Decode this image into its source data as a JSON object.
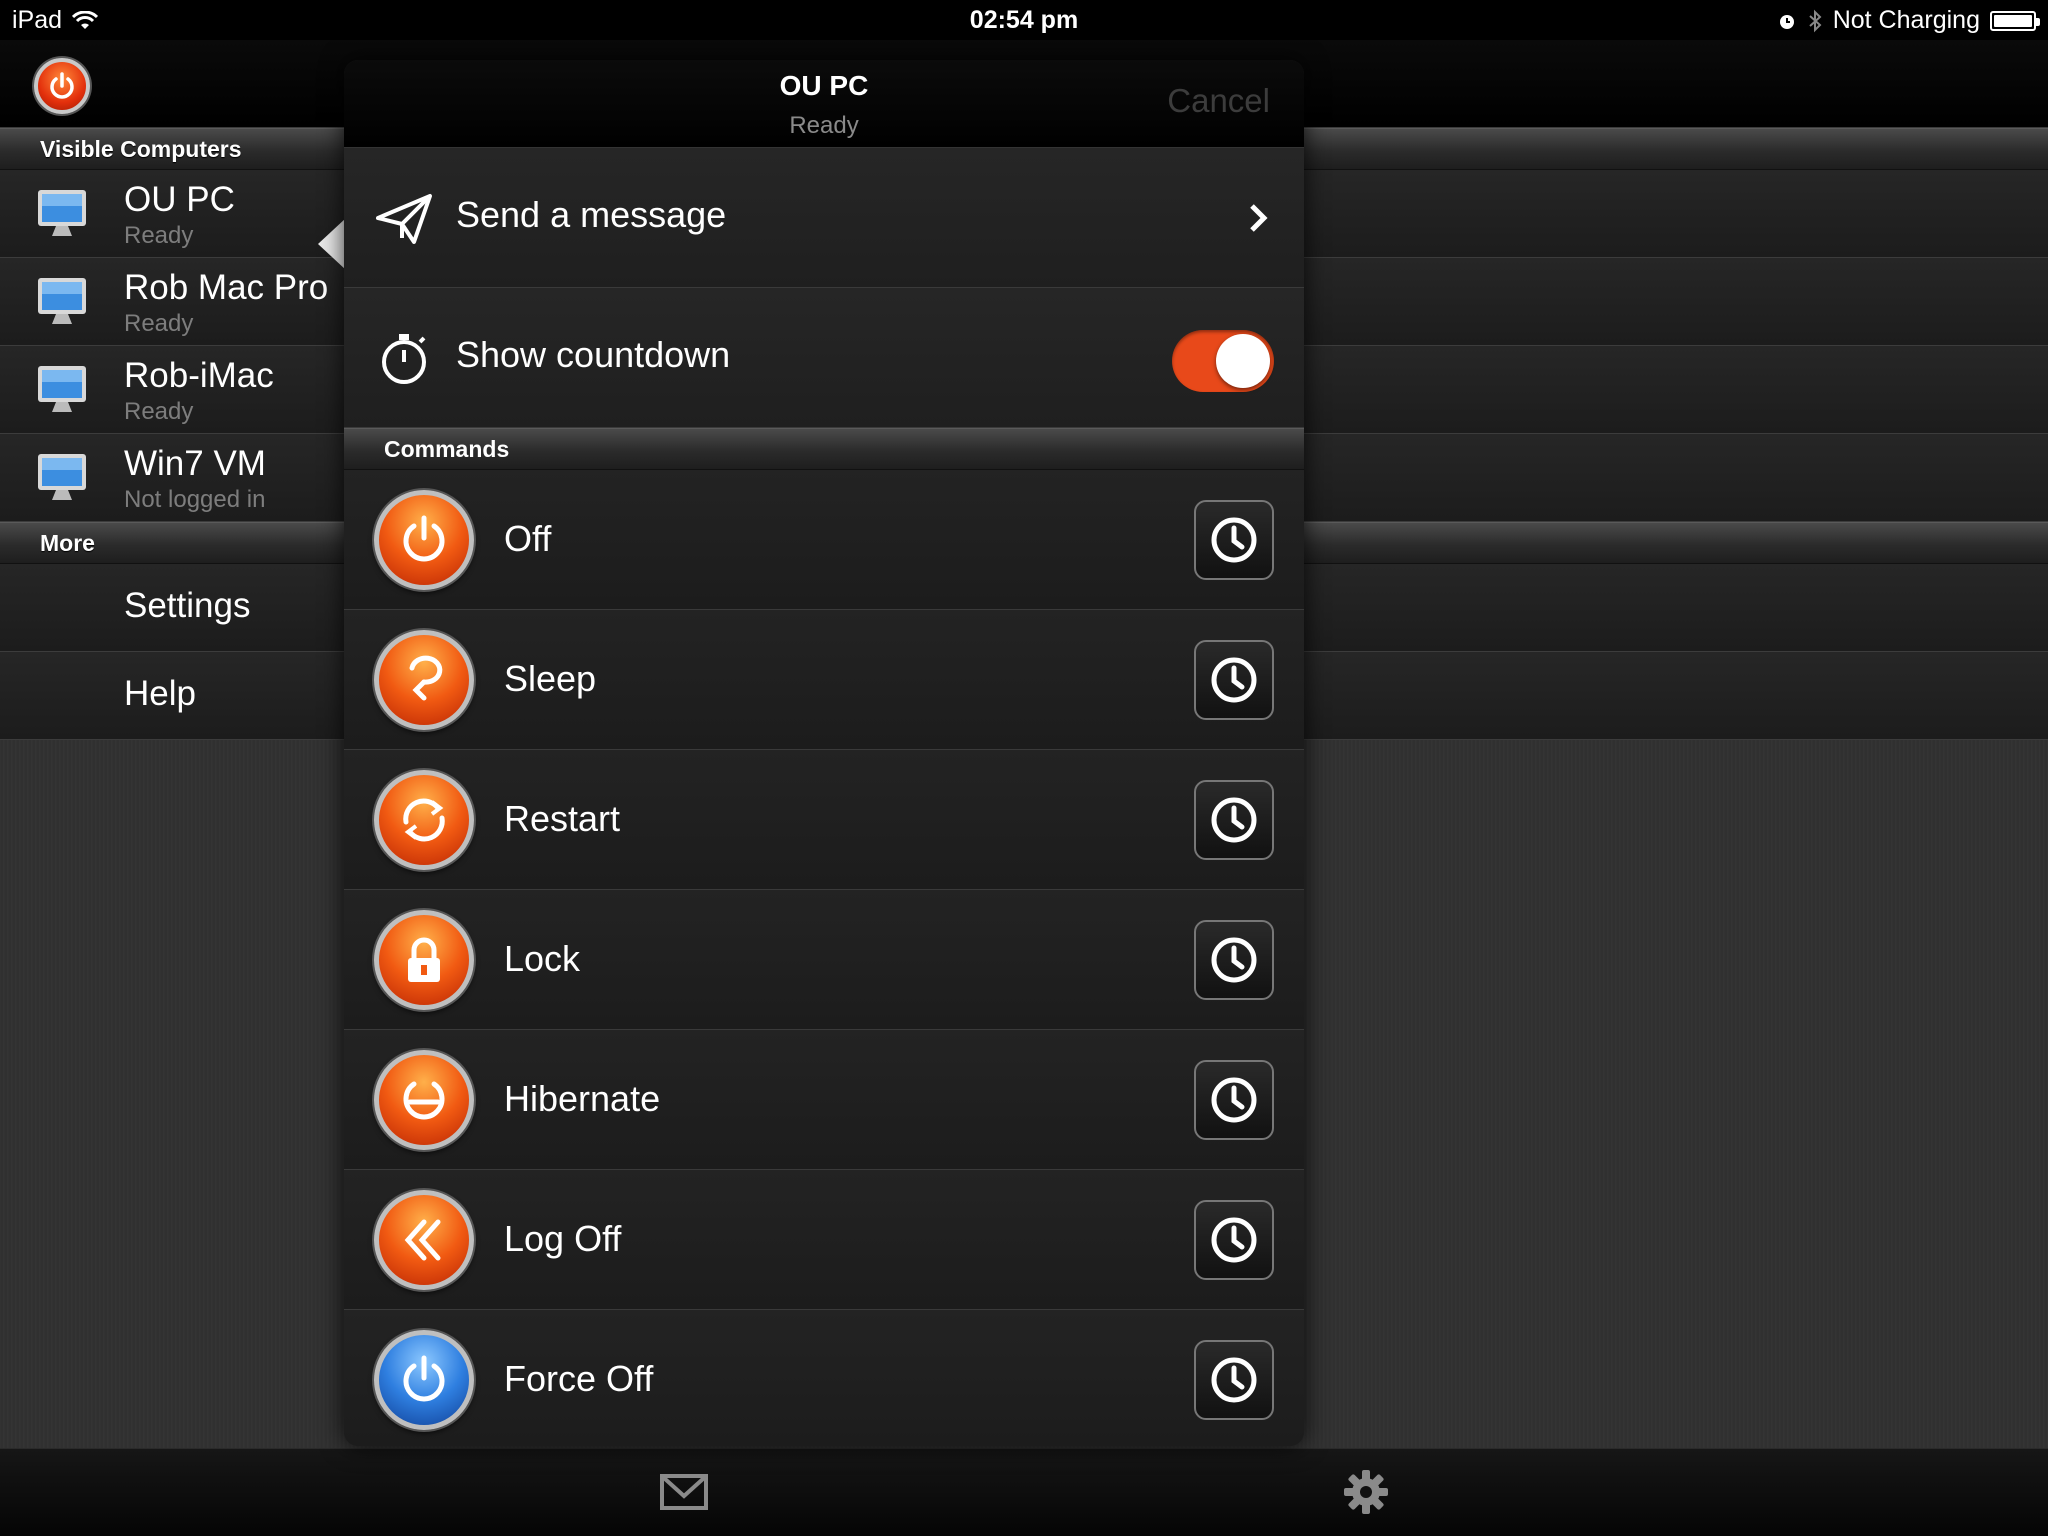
{
  "status_bar": {
    "device": "iPad",
    "time": "02:54 pm",
    "charging": "Not Charging"
  },
  "sidebar": {
    "visible_header": "Visible Computers",
    "computers": [
      {
        "name": "OU PC",
        "status": "Ready"
      },
      {
        "name": "Rob Mac Pro",
        "status": "Ready"
      },
      {
        "name": "Rob-iMac",
        "status": "Ready"
      },
      {
        "name": "Win7 VM",
        "status": "Not logged in"
      }
    ],
    "more_header": "More",
    "more_items": [
      "Settings",
      "Help"
    ]
  },
  "popover": {
    "title": "OU PC",
    "subtitle": "Ready",
    "cancel_label": "Cancel",
    "send_message_label": "Send a message",
    "countdown_label": "Show countdown",
    "countdown_enabled": true,
    "commands_header": "Commands",
    "commands": [
      {
        "label": "Off",
        "icon": "power-icon",
        "color": "orange"
      },
      {
        "label": "Sleep",
        "icon": "sleep-icon",
        "color": "orange"
      },
      {
        "label": "Restart",
        "icon": "restart-icon",
        "color": "orange"
      },
      {
        "label": "Lock",
        "icon": "lock-icon",
        "color": "orange"
      },
      {
        "label": "Hibernate",
        "icon": "hibernate-icon",
        "color": "orange"
      },
      {
        "label": "Log Off",
        "icon": "log-off-icon",
        "color": "orange"
      },
      {
        "label": "Force Off",
        "icon": "power-icon",
        "color": "blue"
      }
    ]
  },
  "colors": {
    "accent_orange": "#e8491a",
    "force_blue": "#2f7fe0"
  }
}
